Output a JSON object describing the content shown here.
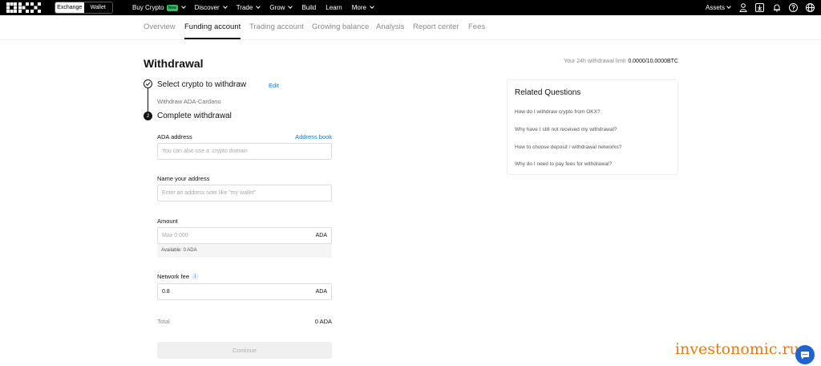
{
  "topbar": {
    "logo_alt": "OKX",
    "toggle": [
      "Exchange",
      "Wallet"
    ],
    "nav": [
      {
        "label": "Buy Crypto",
        "badge": "New"
      },
      {
        "label": "Discover"
      },
      {
        "label": "Trade"
      },
      {
        "label": "Grow"
      },
      {
        "label": "Build"
      },
      {
        "label": "Learn"
      },
      {
        "label": "More"
      }
    ],
    "assets_label": "Assets"
  },
  "tabs": [
    "Overview",
    "Funding account",
    "Trading account",
    "Growing balance",
    "Analysis",
    "Report center",
    "Fees"
  ],
  "active_tab": "Funding account",
  "page": {
    "title": "Withdrawal",
    "limit_label": "Your 24h withdrawal limit",
    "limit_value": "0.0000/10.0000BTC"
  },
  "steps": {
    "step1_label": "Select crypto to withdraw",
    "edit_label": "Edit",
    "step1_sub": "Withdraw ADA-Cardano",
    "step2_number": "2",
    "step2_label": "Complete withdrawal"
  },
  "form": {
    "address_label": "ADA address",
    "address_book": "Address book",
    "address_placeholder": "You can also use a .crypto domain",
    "name_label": "Name your address",
    "name_placeholder": "Enter an address note like \"my wallet\"",
    "amount_label": "Amount",
    "amount_placeholder": "Max 0.000",
    "amount_unit": "ADA",
    "available": "Available:  0 ADA",
    "fee_label": "Network fee",
    "fee_value": "0.8",
    "fee_unit": "ADA",
    "total_label": "Total",
    "total_value": "0 ADA",
    "continue_label": "Continue"
  },
  "related": {
    "title": "Related Questions",
    "items": [
      "How do I withdraw crypto from OKX?",
      "Why have I still not received my withdrawal?",
      "How to choose deposit / withdrawal networks?",
      "Why do I need to pay fees for withdrawal?"
    ]
  },
  "watermark": "investonomic.ru"
}
